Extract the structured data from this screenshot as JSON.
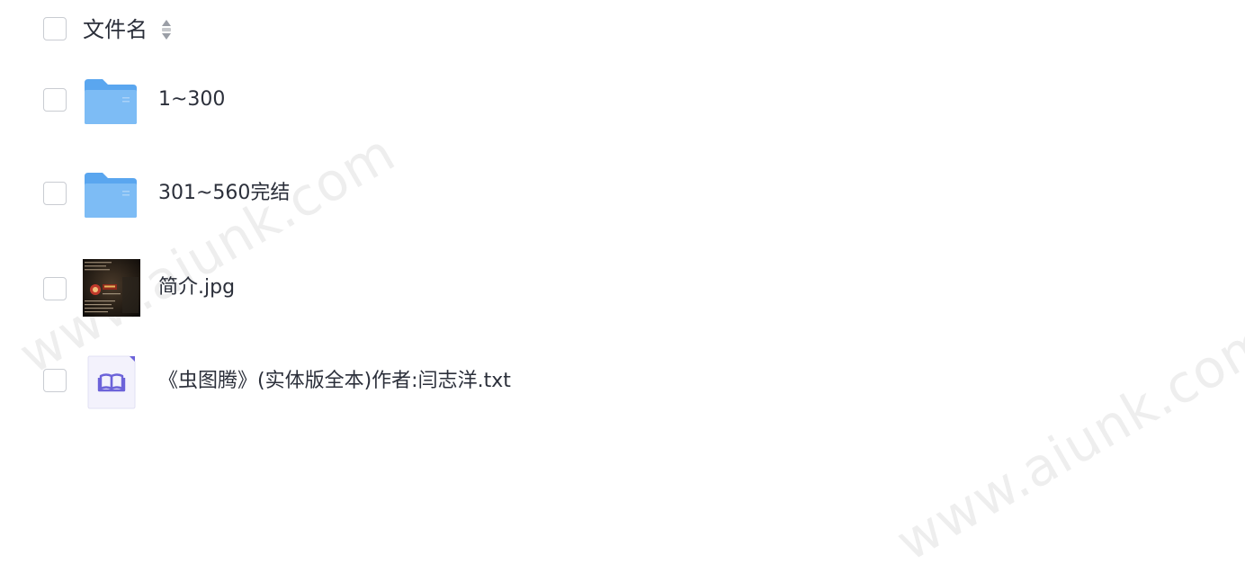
{
  "header": {
    "column_label": "文件名",
    "sort_icon": "sort-icon"
  },
  "files": [
    {
      "name": "1~300",
      "type": "folder",
      "icon": "folder-icon"
    },
    {
      "name": "301~560完结",
      "type": "folder",
      "icon": "folder-icon"
    },
    {
      "name": "简介.jpg",
      "type": "image",
      "icon": "image-thumbnail"
    },
    {
      "name": "《虫图腾》(实体版全本)作者:闫志洋.txt",
      "type": "text",
      "icon": "book-file-icon"
    }
  ],
  "watermark": "www.aiunk.com",
  "colors": {
    "folder": "#7dbcf5",
    "folder_dark": "#5aa6ef",
    "book_accent": "#6c63d9",
    "text": "#2b2f3a",
    "checkbox_border": "#c9ccd2"
  }
}
